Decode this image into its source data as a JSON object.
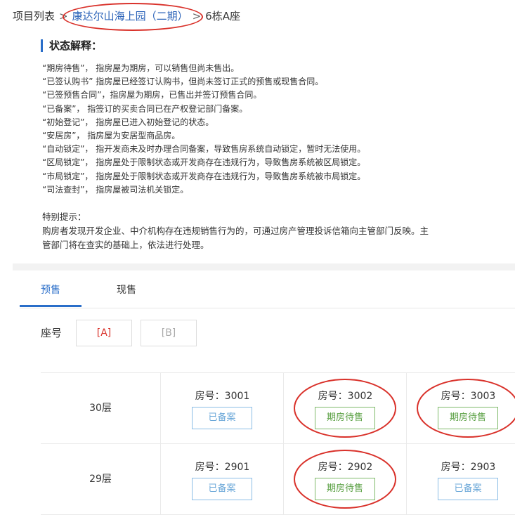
{
  "breadcrumb": {
    "root": "项目列表",
    "separator": ">",
    "project": "康达尔山海上园（二期）",
    "building": "6栋A座"
  },
  "legend": {
    "title": "状态解释：",
    "items": [
      "“期房待售”，   指房屋为期房，可以销售但尚未售出。",
      "“已签认购书”  指房屋已经签订认购书，但尚未签订正式的预售或现售合同。",
      "“已签预售合同”，指房屋为期房，已售出并签订预售合同。",
      "“已备案”，   指签订的买卖合同已在产权登记部门备案。",
      "“初始登记”，   指房屋已进入初始登记的状态。",
      "“安居房”，  指房屋为安居型商品房。",
      "“自动锁定”，  指开发商未及时办理合同备案，导致售房系统自动锁定，暂时无法使用。",
      "“区局锁定”，   指房屋处于限制状态或开发商存在违规行为，导致售房系统被区局锁定。",
      "“市局锁定”，   指房屋处于限制状态或开发商存在违规行为，导致售房系统被市局锁定。",
      "“司法查封”，  指房屋被司法机关锁定。"
    ]
  },
  "tips": {
    "heading": "特别提示：",
    "body": "购房者发现开发企业、中介机构存在违规销售行为的，可通过房产管理投诉信箱向主管部门反映。主管部门将在查实的基础上，依法进行处理。"
  },
  "tabs": [
    "预售",
    "现售"
  ],
  "seat": {
    "label": "座号",
    "options": [
      "[A]",
      "[B]"
    ]
  },
  "floors": [
    {
      "floor": "30层",
      "units": [
        {
          "no": "房号：3001",
          "status": "已备案"
        },
        {
          "no": "房号：3002",
          "status": "期房待售"
        },
        {
          "no": "房号：3003",
          "status": "期房待售"
        }
      ]
    },
    {
      "floor": "29层",
      "units": [
        {
          "no": "房号：2901",
          "status": "已备案"
        },
        {
          "no": "房号：2902",
          "status": "期房待售"
        },
        {
          "no": "房号：2903",
          "status": "已备案"
        }
      ]
    }
  ],
  "colors": {
    "accent": "#2a6ec9",
    "annotation_red": "#d9312a",
    "status_filed": "#6aa7d8",
    "status_presale": "#5aa043"
  }
}
